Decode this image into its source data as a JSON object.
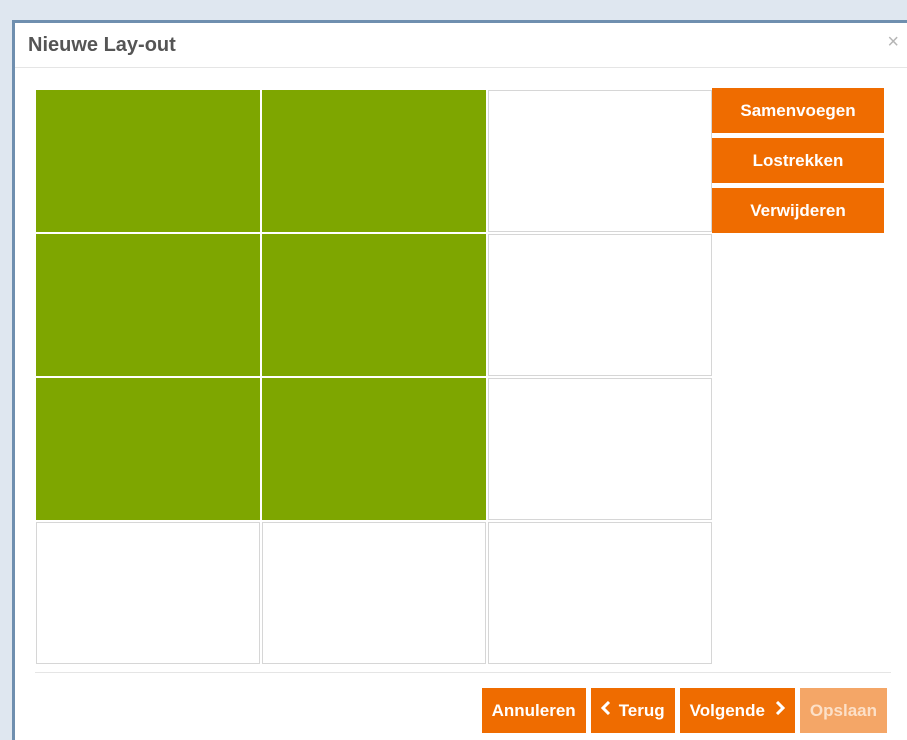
{
  "dialog": {
    "title": "Nieuwe Lay-out",
    "close_symbol": "×"
  },
  "grid": {
    "columns": 3,
    "rows": 4,
    "selected_color": "#7ea600",
    "selected_cells": [
      [
        true,
        true,
        false
      ],
      [
        true,
        true,
        false
      ],
      [
        true,
        true,
        false
      ],
      [
        false,
        false,
        false
      ]
    ]
  },
  "side_actions": {
    "merge_label": "Samenvoegen",
    "split_label": "Lostrekken",
    "delete_label": "Verwijderen"
  },
  "footer": {
    "cancel_label": "Annuleren",
    "back_label": "Terug",
    "next_label": "Volgende",
    "save_label": "Opslaan",
    "save_disabled": true
  },
  "colors": {
    "accent": "#ef6c00",
    "accent_disabled": "#f4a667",
    "frame_border": "#6f8faf"
  },
  "icons": {
    "back": "chevron-left-icon",
    "next": "chevron-right-icon",
    "close": "close-icon"
  }
}
